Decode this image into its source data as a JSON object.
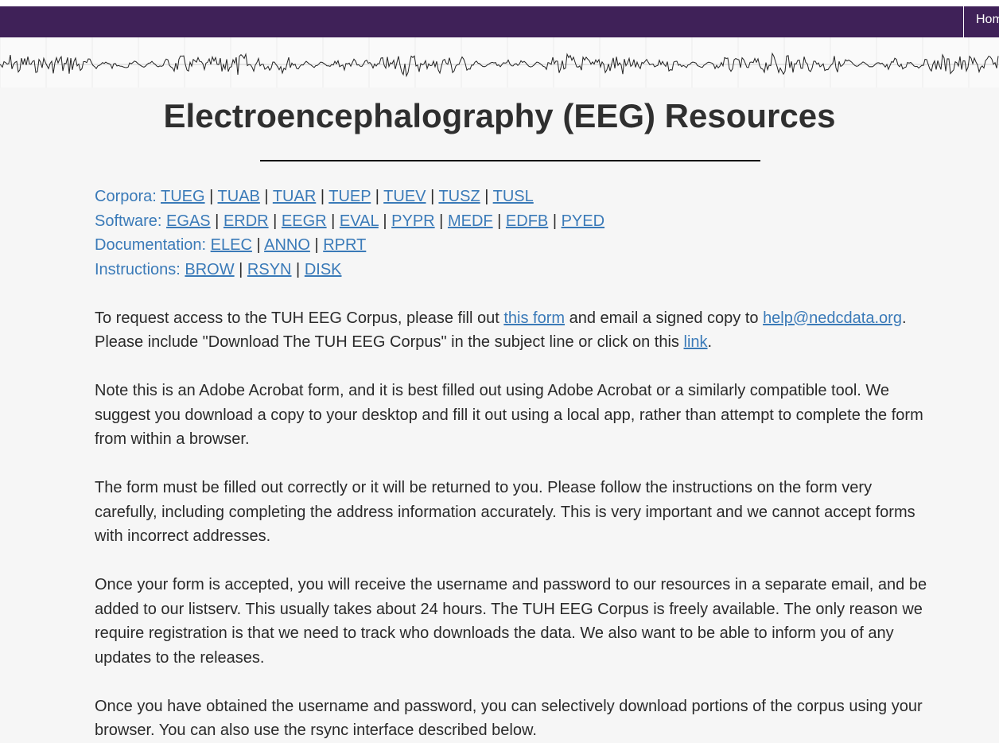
{
  "nav": {
    "home_label": "Home"
  },
  "page": {
    "title": "Electroencephalography (EEG) Resources"
  },
  "resources": [
    {
      "label": "Corpora:",
      "links": [
        "TUEG",
        "TUAB",
        "TUAR",
        "TUEP",
        "TUEV",
        "TUSZ",
        "TUSL"
      ]
    },
    {
      "label": "Software:",
      "links": [
        "EGAS",
        "ERDR",
        "EEGR",
        "EVAL",
        "PYPR",
        "MEDF",
        "EDFB",
        "PYED"
      ]
    },
    {
      "label": "Documentation:",
      "links": [
        "ELEC",
        "ANNO",
        "RPRT"
      ]
    },
    {
      "label": "Instructions:",
      "links": [
        "BROW",
        "RSYN",
        "DISK"
      ]
    }
  ],
  "para1": {
    "t1": "To request access to the TUH EEG Corpus, please fill out ",
    "link1": "this form",
    "t2": " and email a signed copy to ",
    "email": "help@nedcdata.org",
    "t3": ". Please include \"Download The TUH EEG Corpus\" in the subject line or click on this ",
    "link2": "link",
    "t4": "."
  },
  "para2": "Note this is an Adobe Acrobat form, and it is best filled out using Adobe Acrobat or a similarly compatible tool. We suggest you download a copy to your desktop and fill it out using a local app, rather than attempt to complete the form from within a browser.",
  "para3": "The form must be filled out correctly or it will be returned to you. Please follow the instructions on the form very carefully, including completing the address information accurately. This is very important and we cannot accept forms with incorrect addresses.",
  "para4": "Once your form is accepted, you will receive the username and password to our resources in a separate email, and be added to our listserv. This usually takes about 24 hours. The TUH EEG Corpus is freely available. The only reason we require registration is that we need to track who downloads the data. We also want to be able to inform you of any updates to the releases.",
  "para5": "Once you have obtained the username and password, you can selectively download portions of the corpus using your browser. You can also use the rsync interface described below.",
  "colors": {
    "navbar": "#3f2158",
    "link": "#3a7ab8",
    "background": "#f6f6f6"
  }
}
